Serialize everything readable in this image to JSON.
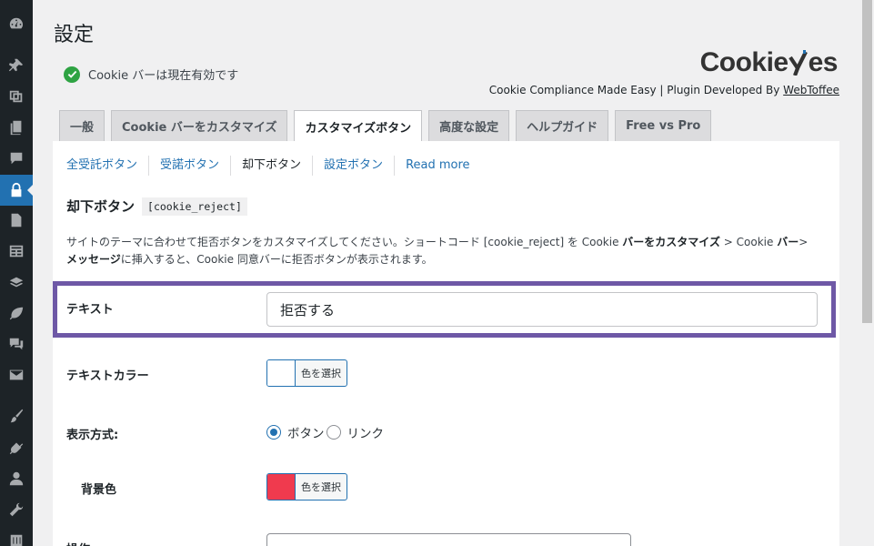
{
  "sidebar": {
    "icons": [
      "dashboard-icon",
      "pin-icon",
      "media-icon",
      "pages-icon",
      "comments-icon",
      "lock-icon",
      "page-icon",
      "forms-icon",
      "layers-icon",
      "leaf-icon",
      "chat-icon",
      "mail-icon",
      "brush-icon",
      "plugin-icon",
      "user-icon",
      "wrench-icon",
      "settings-icon"
    ],
    "current": "lock-icon",
    "colors": {
      "bg": "#1d2327",
      "current": "#2271b1"
    }
  },
  "page": {
    "title": "設定"
  },
  "status": {
    "text": "Cookie バーは現在有効です"
  },
  "brand": {
    "logo_text_a": "Cookie",
    "logo_text_b": "es",
    "tagline_prefix": "Cookie Compliance Made Easy | Plugin Developed By ",
    "tagline_link": "WebToffee"
  },
  "tabs": [
    {
      "label": "一般",
      "active": false
    },
    {
      "label": "Cookie バーをカスタマイズ",
      "active": false
    },
    {
      "label": "カスタマイズボタン",
      "active": true
    },
    {
      "label": "高度な設定",
      "active": false
    },
    {
      "label": "ヘルプガイド",
      "active": false
    },
    {
      "label": "Free vs Pro",
      "active": false
    }
  ],
  "subtabs": [
    {
      "label": "全受託ボタン",
      "active": false
    },
    {
      "label": "受諾ボタン",
      "active": false
    },
    {
      "label": "却下ボタン",
      "active": true
    },
    {
      "label": "設定ボタン",
      "active": false
    },
    {
      "label": "Read more",
      "active": false
    }
  ],
  "section": {
    "title": "却下ボタン",
    "shortcode": "[cookie_reject]",
    "desc_1": "サイトのテーマに合わせて拒否ボタンをカスタマイズしてください。ショートコード [cookie_reject] を Cookie ",
    "desc_b1": "バーをカスタマイズ",
    "desc_2": " > Cookie ",
    "desc_b2": "バー",
    "desc_3": "> ",
    "desc_b3": "メッセージ",
    "desc_4": "に挿入すると、Cookie 同意バーに拒否ボタンが表示されます。"
  },
  "form": {
    "text_label": "テキスト",
    "text_value": "拒否する",
    "text_color_label": "テキストカラー",
    "text_color_value": "#ffffff",
    "color_button_label": "色を選択",
    "display_label": "表示方式:",
    "display_options": [
      {
        "label": "ボタン",
        "checked": true
      },
      {
        "label": "リンク",
        "checked": false
      }
    ],
    "bg_color_label": "背景色",
    "bg_color_value": "#f03a4e",
    "action_label": "操作"
  },
  "colors": {
    "accent": "#2271b1",
    "highlight": "#6e58a6",
    "success": "#2ea343"
  }
}
